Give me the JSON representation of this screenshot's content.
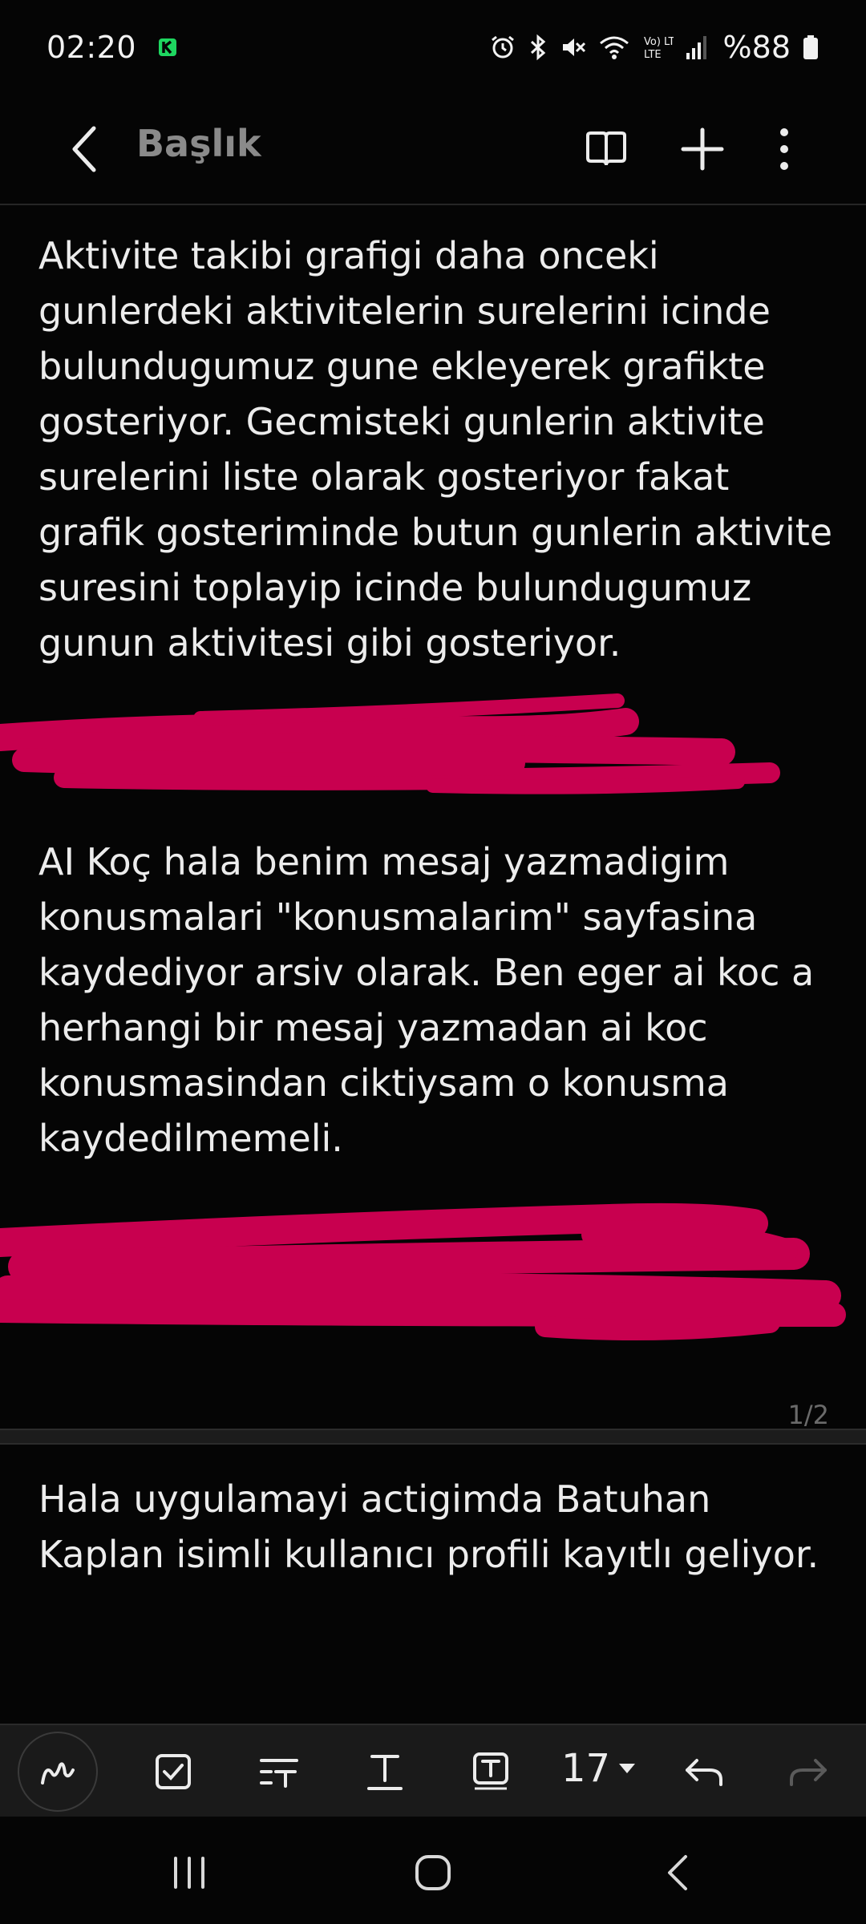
{
  "status": {
    "time": "02:20",
    "battery": "%88",
    "network": "Vo) LTE"
  },
  "header": {
    "title": "Başlık",
    "icons": [
      "back-icon",
      "book-icon",
      "plus-icon",
      "more-vert-icon"
    ]
  },
  "note": {
    "paragraph1": [
      "Aktivite takibi grafigi daha onceki",
      "gunlerdeki aktivitelerin surelerini icinde",
      "bulundugumuz gune ekleyerek grafikte",
      "gosteriyor. Gecmisteki gunlerin aktivite",
      "surelerini liste olarak gosteriyor fakat",
      "grafik gosteriminde butun gunlerin aktivite",
      "suresini toplayip icinde bulundugumuz",
      "gunun aktivitesi gibi gosteriyor."
    ],
    "paragraph2": [
      "AI Koç hala benim mesaj yazmadigim",
      "konusmalari \"konusmalarim\" sayfasina",
      "kaydediyor arsiv olarak. Ben eger ai koc a",
      "herhangi bir mesaj yazmadan ai koc",
      "konusmasindan ciktiysam o konusma",
      "kaydedilmemeli."
    ],
    "page_indicator": "1/2",
    "paragraph3": [
      "Hala uygulamayi actigimda Batuhan",
      "Kaplan isimli kullanıcı profili kayıtlı geliyor."
    ],
    "redaction_color": "#c8004f"
  },
  "toolbar": {
    "font_size": "17",
    "icons": [
      "pen-icon",
      "checkbox-icon",
      "text-style-icon",
      "text-format-icon",
      "text-box-icon",
      "undo-icon",
      "redo-icon"
    ]
  },
  "navbar": {
    "icons": [
      "recents-icon",
      "home-icon",
      "back-nav-icon"
    ]
  }
}
